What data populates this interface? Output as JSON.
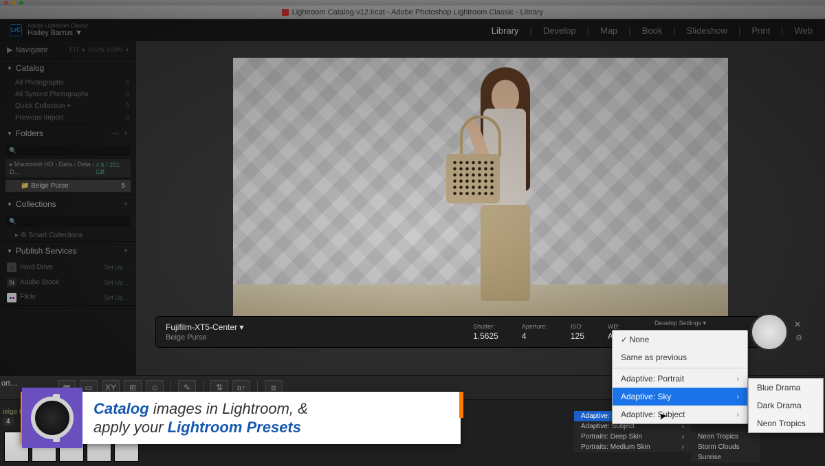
{
  "window": {
    "title": "Lightroom Catalog-v12.lrcat - Adobe Photoshop Lightroom Classic - Library"
  },
  "header": {
    "badge": "LrC",
    "product": "Adobe Lightroom Classic",
    "user": "Hailey Barrus",
    "modules": [
      "Library",
      "Develop",
      "Map",
      "Book",
      "Slideshow",
      "Print",
      "Web"
    ],
    "active_module": "Library"
  },
  "left_panel": {
    "navigator": {
      "label": "Navigator",
      "zoom": "FIT ▾   100%   200% ▾"
    },
    "catalog": {
      "label": "Catalog",
      "items": [
        {
          "label": "All Photographs",
          "count": "5"
        },
        {
          "label": "All Synced Photographs",
          "count": "0"
        },
        {
          "label": "Quick Collection +",
          "count": "0"
        },
        {
          "label": "Previous Import",
          "count": "0"
        }
      ]
    },
    "folders": {
      "label": "Folders",
      "volume": {
        "name": "Macintosh HD › Data › Data › D…",
        "stat": "4.6 / 251 GB"
      },
      "selected": {
        "name": "Beige Purse",
        "count": "5"
      }
    },
    "collections": {
      "label": "Collections",
      "item": "Smart Collections"
    },
    "publish": {
      "label": "Publish Services",
      "items": [
        {
          "ico": "hd",
          "name": "Hard Drive",
          "action": "Set Up…"
        },
        {
          "ico": "st",
          "name": "Adobe Stock",
          "action": "Set Up…"
        },
        {
          "ico": "fl",
          "name": "Flickr",
          "action": "Set Up…"
        }
      ]
    }
  },
  "tether": {
    "camera": "Fujifilm-XT5-Center ▾",
    "collection": "Beige Purse",
    "shutter_label": "Shutter:",
    "shutter": "1.5625",
    "aperture_label": "Aperture:",
    "aperture": "4",
    "iso_label": "ISO:",
    "iso": "125",
    "wb_label": "WB:",
    "wb": "AUTO",
    "dev_label": "Develop Settings ▾"
  },
  "dev_menu": {
    "none": "None",
    "same": "Same as previous",
    "rows": [
      {
        "label": "Adaptive: Portrait",
        "sub": true
      },
      {
        "label": "Adaptive: Sky",
        "sub": true,
        "hl": true
      },
      {
        "label": "Adaptive: Subject",
        "sub": true
      }
    ]
  },
  "sub_menu": [
    "Blue Drama",
    "Dark Drama",
    "Neon Tropics"
  ],
  "ghost_menu": [
    {
      "l": "Adaptive: Subject",
      "r": "›"
    },
    {
      "l": "Portraits: Deep Skin",
      "r": "›"
    },
    {
      "l": "Portraits: Medium Skin",
      "r": "›"
    }
  ],
  "ghost_menu_top": "Adaptive: Sky",
  "ghost_menu2": [
    "Neon Tropics",
    "Storm Clouds",
    "Sunrise"
  ],
  "sort_label": "ort…",
  "left_beige": {
    "label": "ieige P…",
    "num": "4"
  },
  "banner": {
    "word1": "Catalog",
    "part1": " images in Lightroom, &",
    "part2a": "apply your ",
    "word2": "Lightroom Presets"
  }
}
